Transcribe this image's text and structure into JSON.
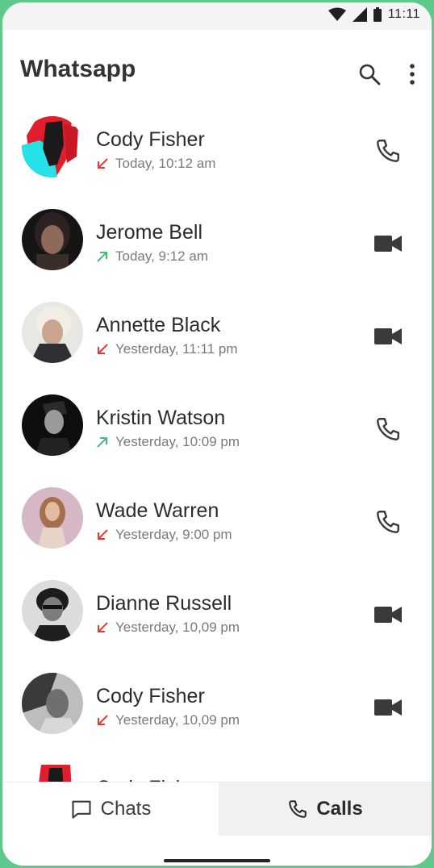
{
  "status_bar": {
    "time": "11:11"
  },
  "app": {
    "title": "Whatsapp"
  },
  "calls": [
    {
      "name": "Cody Fisher",
      "time": "Today, 10:12 am",
      "direction": "missed",
      "type": "voice"
    },
    {
      "name": "Jerome Bell",
      "time": "Today, 9:12 am",
      "direction": "outgoing",
      "type": "video"
    },
    {
      "name": "Annette Black",
      "time": "Yesterday, 11:11 pm",
      "direction": "missed",
      "type": "video"
    },
    {
      "name": "Kristin Watson",
      "time": "Yesterday, 10:09  pm",
      "direction": "outgoing",
      "type": "voice"
    },
    {
      "name": "Wade Warren",
      "time": "Yesterday, 9:00  pm",
      "direction": "missed",
      "type": "voice"
    },
    {
      "name": "Dianne Russell",
      "time": "Yesterday, 10,09  pm",
      "direction": "missed",
      "type": "video"
    },
    {
      "name": "Cody Fisher",
      "time": "Yesterday, 10,09  pm",
      "direction": "missed",
      "type": "video"
    }
  ],
  "peek_row": {
    "name": "Cody Fisher"
  },
  "bottom_nav": {
    "chats_label": "Chats",
    "calls_label": "Calls",
    "active": "calls"
  },
  "colors": {
    "missed": "#e53935",
    "outgoing": "#3fbf72",
    "icon": "#3a3a3a"
  }
}
